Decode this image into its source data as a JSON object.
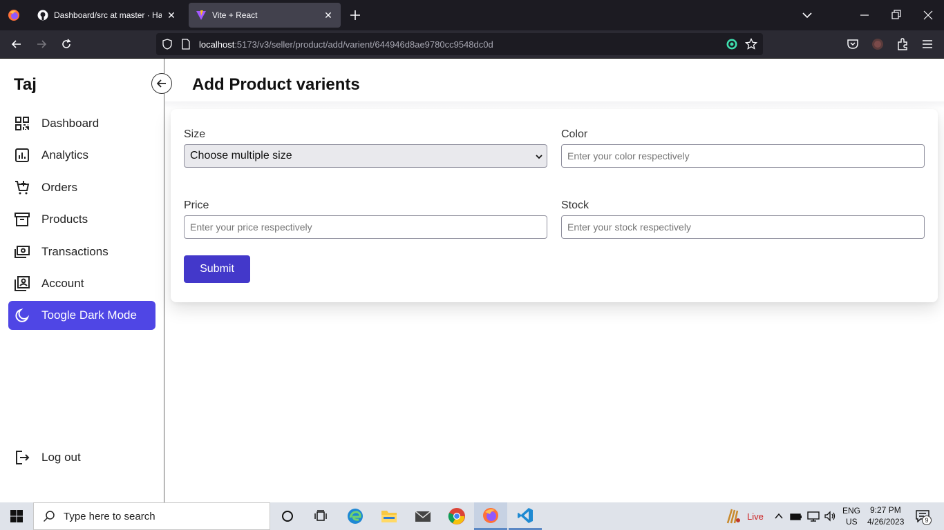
{
  "browser": {
    "tabs": [
      {
        "title": "Dashboard/src at master · Hayat",
        "active": false
      },
      {
        "title": "Vite + React",
        "active": true
      }
    ],
    "url_host": "localhost",
    "url_path": ":5173/v3/seller/product/add/varient/644946d8ae9780cc9548dc0d"
  },
  "sidebar": {
    "brand": "Taj",
    "items": [
      {
        "label": "Dashboard",
        "icon": "grid-icon"
      },
      {
        "label": "Analytics",
        "icon": "chart-icon"
      },
      {
        "label": "Orders",
        "icon": "cart-icon"
      },
      {
        "label": "Products",
        "icon": "archive-icon"
      },
      {
        "label": "Transactions",
        "icon": "money-icon"
      },
      {
        "label": "Account",
        "icon": "account-icon"
      },
      {
        "label": "Toogle Dark Mode",
        "icon": "moon-icon",
        "active": true
      }
    ],
    "logout": "Log out"
  },
  "main": {
    "title": "Add Product varients",
    "form": {
      "size_label": "Size",
      "size_value": "Choose multiple size",
      "color_label": "Color",
      "color_placeholder": "Enter your color respectively",
      "price_label": "Price",
      "price_placeholder": "Enter your price respectively",
      "stock_label": "Stock",
      "stock_placeholder": "Enter your stock respectively",
      "submit": "Submit"
    }
  },
  "taskbar": {
    "search_placeholder": "Type here to search",
    "live": "Live",
    "lang_1": "ENG",
    "lang_2": "US",
    "time": "9:27 PM",
    "date": "4/26/2023",
    "notifications": "9"
  },
  "colors": {
    "accent": "#4f46e5",
    "submit": "#4338ca",
    "browser_bg": "#1c1b22"
  }
}
